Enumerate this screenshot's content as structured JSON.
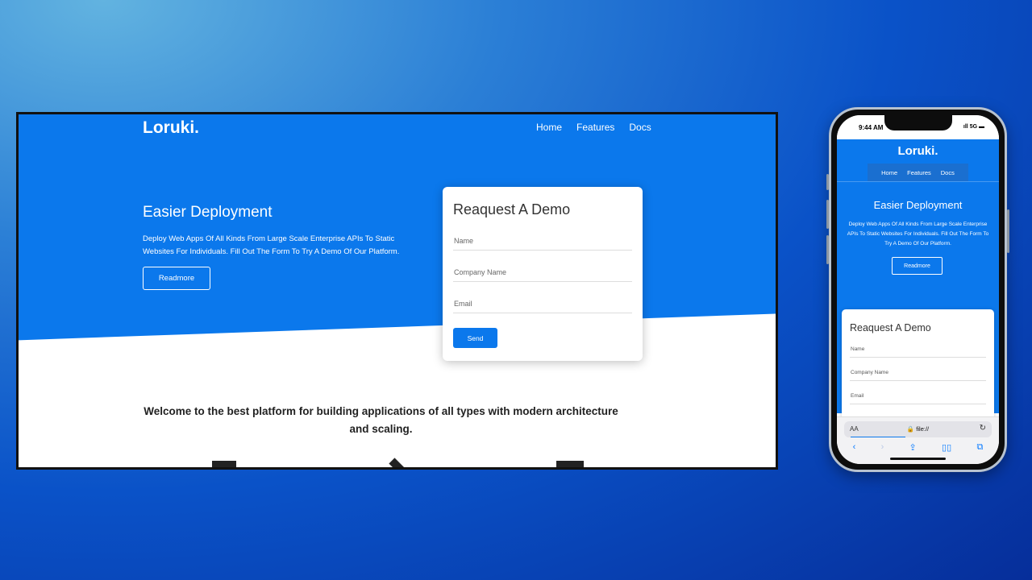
{
  "desktop": {
    "brand": "Loruki.",
    "nav": [
      "Home",
      "Features",
      "Docs"
    ],
    "hero": {
      "title": "Easier Deployment",
      "description": "Deploy Web Apps Of All Kinds From Large Scale Enterprise APIs To Static Websites For Individuals. Fill Out The Form To Try A Demo Of Our Platform.",
      "button": "Readmore"
    },
    "form": {
      "title": "Reaquest A Demo",
      "fields": [
        "Name",
        "Company Name",
        "Email"
      ],
      "submit": "Send"
    },
    "welcome": "Welcome to the best platform for building applications of all types with modern architecture and scaling."
  },
  "phone": {
    "time": "9:44 AM",
    "signal": "5G",
    "brand": "Loruki.",
    "nav": [
      "Home",
      "Features",
      "Docs"
    ],
    "hero": {
      "title": "Easier Deployment",
      "description": "Deploy Web Apps Of All Kinds From Large Scale Enterprise APIs To Static Websites For Individuals. Fill Out The Form To Try A Demo Of Our Platform.",
      "button": "Readmore"
    },
    "form": {
      "title": "Reaquest A Demo",
      "fields": [
        "Name",
        "Company Name",
        "Email"
      ]
    },
    "browser": {
      "text_size": "AA",
      "url": "🔒 file://"
    }
  },
  "colors": {
    "primary": "#0b78ec",
    "background_dark": "#062e9a",
    "background_light": "#62b3e0"
  }
}
